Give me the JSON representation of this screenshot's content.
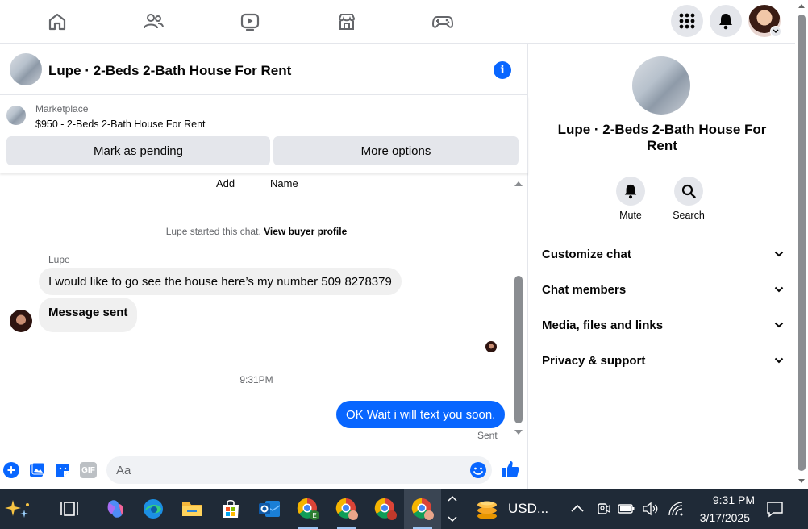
{
  "nav": {
    "icons": [
      "home-icon",
      "friends-icon",
      "video-icon",
      "marketplace-icon",
      "gaming-icon"
    ],
    "right": [
      "menu-grid-icon",
      "notifications-icon",
      "profile-avatar"
    ]
  },
  "chat": {
    "title": "Lupe · 2-Beds 2-Bath House For Rent",
    "marketplace_label": "Marketplace",
    "listing": "$950 - 2-Beds 2-Bath House For Rent",
    "mark_pending": "Mark as pending",
    "more_options": "More options",
    "field_add": "Add",
    "field_name": "Name",
    "started_text": "Lupe started this chat.",
    "view_buyer": "View buyer profile",
    "sender_name": "Lupe",
    "msg1": "I would like to go see the house here’s my number 509 8278379",
    "msg2": "Message sent",
    "time": "9:31PM",
    "msg3": "OK Wait i will text you soon.",
    "status": "Sent",
    "composer_placeholder": "Aa",
    "gif": "GIF"
  },
  "info": {
    "title": "Lupe · 2-Beds 2-Bath House For Rent",
    "mute": "Mute",
    "search": "Search",
    "sections": [
      "Customize chat",
      "Chat members",
      "Media, files and links",
      "Privacy & support"
    ]
  },
  "taskbar": {
    "ticker": "USD...",
    "time": "9:31 PM",
    "date": "3/17/2025"
  },
  "colors": {
    "accent": "#0866ff",
    "taskbar": "#1f2a37"
  }
}
